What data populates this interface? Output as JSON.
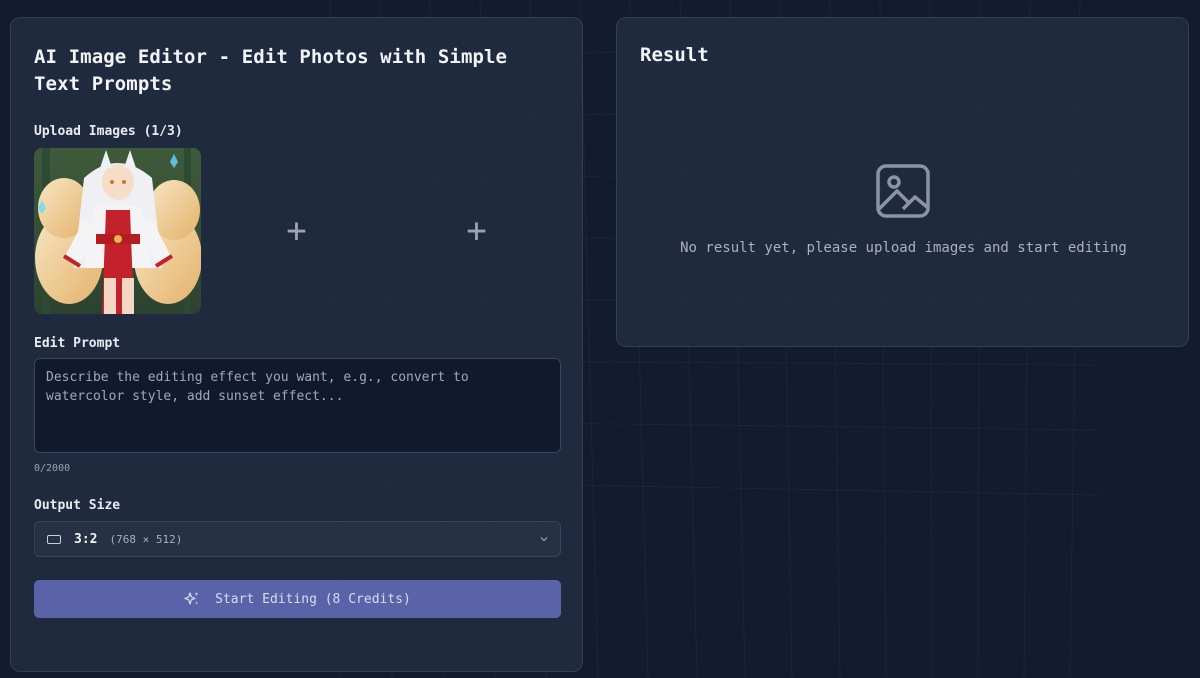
{
  "editor": {
    "title": "AI Image Editor - Edit Photos with Simple Text Prompts",
    "upload_label": "Upload Images (1/3)",
    "uploaded_image_icon": "anime-fox-girl-thumbnail",
    "add_slots": [
      "+",
      "+"
    ],
    "prompt_label": "Edit Prompt",
    "prompt_value": "",
    "prompt_placeholder": "Describe the editing effect you want, e.g., convert to watercolor style, add sunset effect...",
    "char_counter": "0/2000",
    "size_label": "Output Size",
    "size_ratio": "3:2",
    "size_dims": "(768 × 512)",
    "start_button": "Start Editing (8 Credits)"
  },
  "result": {
    "title": "Result",
    "placeholder_icon": "image-icon",
    "empty_message": "No result yet, please upload images and start editing"
  },
  "colors": {
    "background": "#131b2e",
    "panel": "#242e42",
    "button": "#5a63a8"
  }
}
